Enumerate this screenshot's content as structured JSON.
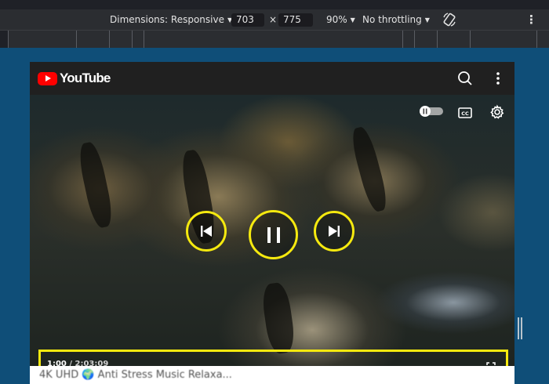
{
  "devtools": {
    "dimensions_label": "Dimensions: Responsive",
    "width_value": "703",
    "times_sign": "×",
    "height_value": "775",
    "zoom": "90%",
    "throttling": "No throttling",
    "caret": "▼",
    "kebab": "⋮"
  },
  "youtube": {
    "logo_text": "YouTube",
    "search_icon": "search-icon",
    "menu_icon": "more-vert-icon"
  },
  "player": {
    "current_time": "1:00",
    "separator": " / ",
    "duration": "2:03:09",
    "progress": 0.008,
    "autoplay_icon": "autoplay-toggle-icon",
    "captions_icon": "cc-icon",
    "settings_icon": "gear-icon",
    "highlight_color": "#f5e90f",
    "progress_color": "#ff0000"
  },
  "below_video": {
    "title_fragment": "4K UHD 🌍 Anti Stress Music Relaxa..."
  }
}
